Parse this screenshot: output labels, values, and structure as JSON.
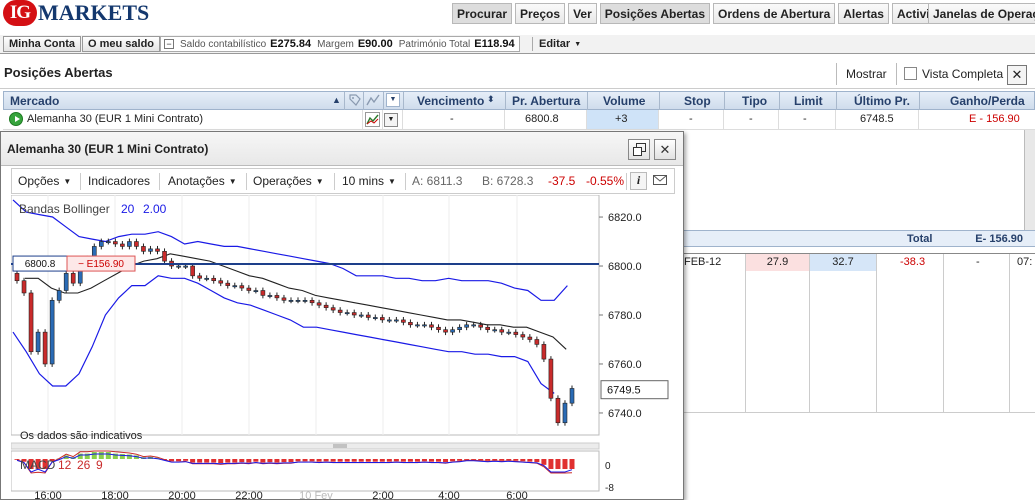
{
  "brand": {
    "logo_mark": "IG",
    "logo_text": "MARKETS",
    "logo_color": "#14386e",
    "mark_color": "#d40f14"
  },
  "nav": [
    "Procurar",
    "Preços",
    "Ver",
    "Posições Abertas",
    "Ordens de Abertura",
    "Alertas",
    "Actividade"
  ],
  "nav_right": "Janelas de Operaç",
  "account": {
    "minha_conta": "Minha Conta",
    "meu_saldo": "O meu saldo",
    "collapse_icon": "minus-icon",
    "saldo_label": "Saldo contabilístico",
    "saldo_value": "E275.84",
    "margem_label": "Margem",
    "margem_value": "E90.00",
    "patrimonio_label": "Património Total",
    "patrimonio_value": "E118.94",
    "editar": "Editar"
  },
  "positions": {
    "title": "Posições Abertas",
    "mostrar": "Mostrar",
    "vista_completa": "Vista Completa",
    "close_icon": "close-icon",
    "columns": [
      "Mercado",
      "Vencimento",
      "Pr. Abertura",
      "Volume",
      "Stop",
      "Tipo",
      "Limit",
      "Último Pr.",
      "Ganho/Perda"
    ],
    "row": {
      "market": "Alemanha 30 (EUR 1 Mini Contrato)",
      "vencimento": "-",
      "abertura": "6800.8",
      "volume": "+3",
      "stop": "-",
      "tipo": "-",
      "limit": "-",
      "ultimo": "6748.5",
      "ganho": "E - 156.90"
    },
    "total_label": "Total",
    "total_value": "E- 156.90",
    "accent_red": "#cc0000",
    "header_color": "#26406b"
  },
  "lower_row": {
    "expiry": "FEB-12",
    "sell": "27.9",
    "buy": "32.7",
    "change": "-38.3",
    "dash": "-",
    "time": "07:"
  },
  "chart_window": {
    "title": "Alemanha 30 (EUR 1 Mini Contrato)",
    "toolbar": {
      "opcoes": "Opções",
      "indicadores": "Indicadores",
      "anotacoes": "Anotações",
      "operacoes": "Operações",
      "interval": "10 mins",
      "ask": "A: 6811.3",
      "bid": "B: 6728.3",
      "change": "-37.5",
      "change_pct": "-0.55%",
      "info_icon": "info-icon",
      "mail_icon": "mail-icon"
    },
    "restore_icon": "restore-window-icon",
    "close_icon": "close-icon"
  },
  "chart_data": {
    "type": "candlestick",
    "indicator_label": "Bandas Bollinger",
    "indicator_params": [
      "20",
      "2.00"
    ],
    "macd_label": "MACD",
    "macd_params": [
      "12",
      "26",
      "9"
    ],
    "note": "Os dados são indicativos",
    "position_level": 6800.8,
    "position_label": "6800.8",
    "position_pl": "− E156.90",
    "last_price": 6749.5,
    "last_label": "6749.5",
    "y_ticks": [
      6820.0,
      6800.0,
      6780.0,
      6760.0,
      6740.0
    ],
    "ylim": [
      6731,
      6829
    ],
    "macd_ticks": [
      "0",
      "-8"
    ],
    "x_ticks": [
      "16:00",
      "18:00",
      "20:00",
      "22:00",
      "10 Fev",
      "2:00",
      "4:00",
      "6:00"
    ],
    "closes": [
      6794,
      6789,
      6765,
      6773,
      6760,
      6786,
      6790,
      6797,
      6793,
      6801,
      6803,
      6808,
      6810,
      6810,
      6809,
      6808,
      6810,
      6808,
      6806,
      6807,
      6806,
      6802,
      6800,
      6800,
      6800,
      6796,
      6795,
      6795,
      6794,
      6793,
      6792,
      6792,
      6791,
      6790,
      6790,
      6788,
      6788,
      6787,
      6786,
      6786,
      6786,
      6786,
      6785,
      6784,
      6783,
      6782,
      6781,
      6781,
      6780,
      6780,
      6779,
      6779,
      6778,
      6778,
      6778,
      6777,
      6776,
      6776,
      6776,
      6775,
      6774,
      6773,
      6774,
      6775,
      6776,
      6776,
      6775,
      6774,
      6774,
      6773,
      6773,
      6772,
      6771,
      6770,
      6768,
      6762,
      6746,
      6736,
      6744,
      6750
    ],
    "upper_band": [
      6827,
      6822,
      6821,
      6820,
      6816,
      6812,
      6811,
      6810,
      6812,
      6813,
      6813,
      6814,
      6812,
      6809,
      6810,
      6809,
      6808,
      6808,
      6807,
      6806,
      6805,
      6804,
      6803,
      6802,
      6801,
      6799,
      6796,
      6796,
      6796,
      6795,
      6795,
      6794,
      6794,
      6795,
      6794,
      6794,
      6794,
      6793,
      6791,
      6790,
      6786,
      6786,
      6792
    ],
    "middle_band": [
      6795,
      6795,
      6791,
      6789,
      6789,
      6791,
      6794,
      6797,
      6800,
      6802,
      6803,
      6805,
      6804,
      6803,
      6802,
      6800,
      6798,
      6796,
      6795,
      6793,
      6791,
      6790,
      6788,
      6787,
      6786,
      6785,
      6784,
      6783,
      6782,
      6781,
      6780,
      6779,
      6778,
      6778,
      6777,
      6776,
      6776,
      6775,
      6775,
      6773,
      6771,
      6766
    ],
    "lower_band": [
      6773,
      6765,
      6756,
      6751,
      6751,
      6756,
      6767,
      6780,
      6787,
      6792,
      6792,
      6796,
      6795,
      6795,
      6793,
      6790,
      6787,
      6785,
      6784,
      6782,
      6780,
      6778,
      6775,
      6775,
      6774,
      6773,
      6772,
      6771,
      6770,
      6769,
      6768,
      6767,
      6766,
      6765,
      6765,
      6764,
      6764,
      6763,
      6763,
      6761,
      6752,
      6748
    ],
    "colors": {
      "band": "#1a1ae6",
      "middle": "#222222",
      "up": "#2a6bb5",
      "down": "#c92b2b",
      "position_line": "#1d3f8a",
      "macd_up": "#8bd04a",
      "macd_down": "#e03030"
    }
  }
}
